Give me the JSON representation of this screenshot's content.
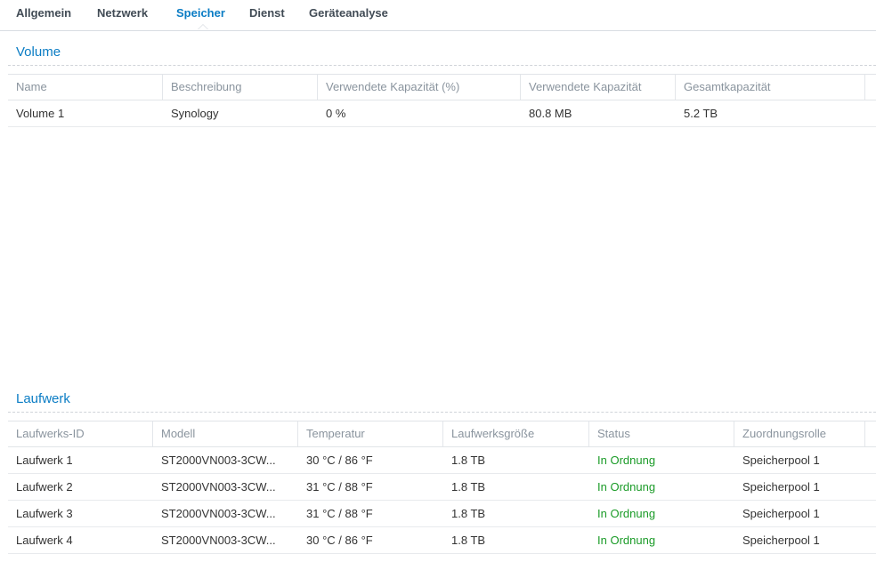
{
  "tabs": [
    {
      "label": "Allgemein"
    },
    {
      "label": "Netzwerk"
    },
    {
      "label": "Speicher",
      "active": true
    },
    {
      "label": "Dienst"
    },
    {
      "label": "Geräteanalyse"
    }
  ],
  "volume": {
    "title": "Volume",
    "columns": [
      "Name",
      "Beschreibung",
      "Verwendete Kapazität (%)",
      "Verwendete Kapazität",
      "Gesamtkapazität"
    ],
    "rows": [
      [
        "Volume 1",
        "Synology",
        "0 %",
        "80.8 MB",
        "5.2 TB"
      ]
    ]
  },
  "drives": {
    "title": "Laufwerk",
    "columns": [
      "Laufwerks-ID",
      "Modell",
      "Temperatur",
      "Laufwerksgröße",
      "Status",
      "Zuordnungsrolle"
    ],
    "rows": [
      [
        "Laufwerk 1",
        "ST2000VN003-3CW...",
        "30 °C / 86 °F",
        "1.8 TB",
        "In Ordnung",
        "Speicherpool 1"
      ],
      [
        "Laufwerk 2",
        "ST2000VN003-3CW...",
        "31 °C / 88 °F",
        "1.8 TB",
        "In Ordnung",
        "Speicherpool 1"
      ],
      [
        "Laufwerk 3",
        "ST2000VN003-3CW...",
        "31 °C / 88 °F",
        "1.8 TB",
        "In Ordnung",
        "Speicherpool 1"
      ],
      [
        "Laufwerk 4",
        "ST2000VN003-3CW...",
        "30 °C / 86 °F",
        "1.8 TB",
        "In Ordnung",
        "Speicherpool 1"
      ]
    ]
  },
  "colors": {
    "accent": "#0a7cc4",
    "status_ok": "#1a9b27"
  }
}
